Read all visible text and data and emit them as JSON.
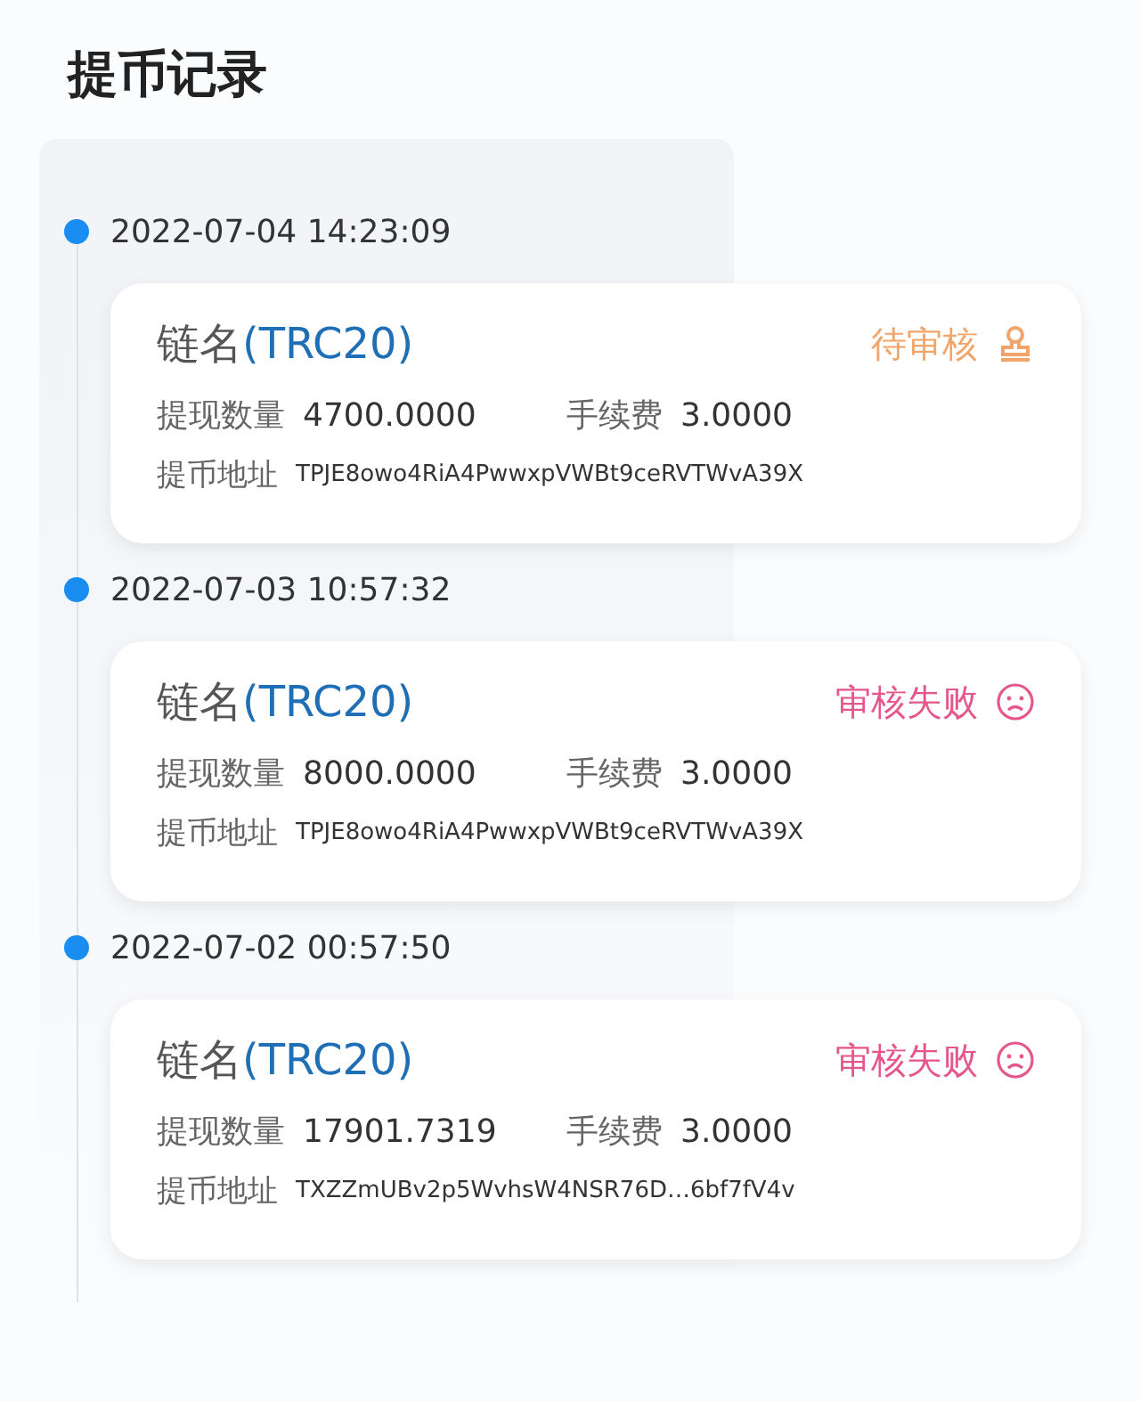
{
  "title": "提币记录",
  "records": [
    {
      "time": "2022-07-04 14:23:09",
      "chain_label": "链名",
      "chain": "(TRC20)",
      "status": {
        "text": "待审核",
        "kind": "pending"
      },
      "amount_label": "提现数量",
      "amount": "4700.0000",
      "fee_label": "手续费",
      "fee": "3.0000",
      "address_label": "提币地址",
      "address": "TPJE8owo4RiA4PwwxpVWBt9ceRVTWvA39X"
    },
    {
      "time": "2022-07-03 10:57:32",
      "chain_label": "链名",
      "chain": "(TRC20)",
      "status": {
        "text": "审核失败",
        "kind": "failed"
      },
      "amount_label": "提现数量",
      "amount": "8000.0000",
      "fee_label": "手续费",
      "fee": "3.0000",
      "address_label": "提币地址",
      "address": "TPJE8owo4RiA4PwwxpVWBt9ceRVTWvA39X"
    },
    {
      "time": "2022-07-02 00:57:50",
      "chain_label": "链名",
      "chain": "(TRC20)",
      "status": {
        "text": "审核失败",
        "kind": "failed"
      },
      "amount_label": "提现数量",
      "amount": "17901.7319",
      "fee_label": "手续费",
      "fee": "3.0000",
      "address_label": "提币地址",
      "address": "TXZZmUBv2p5WvhsW4NSR76D…6bf7fV4v"
    }
  ]
}
